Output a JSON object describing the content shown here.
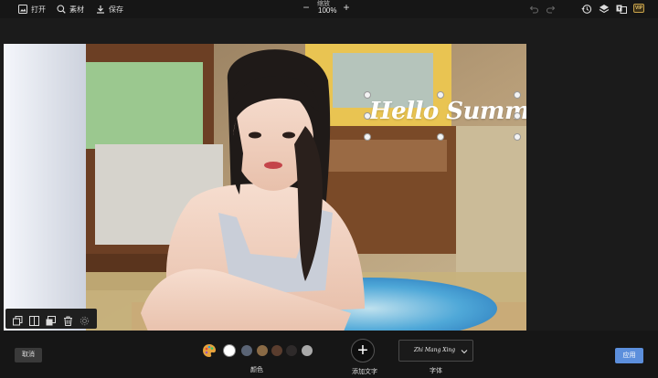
{
  "toolbar": {
    "open_label": "打开",
    "assets_label": "素材",
    "save_label": "保存",
    "zoom_label": "缩放",
    "zoom_value": "100%",
    "vip_label": "VIP"
  },
  "canvas": {
    "overlay_text": "Hello Summer"
  },
  "bottom": {
    "cancel_label": "取消",
    "apply_label": "应用",
    "color_label": "颜色",
    "add_text_label": "添加文字",
    "font_label": "字体",
    "font_value": "Zhi Mang Xing",
    "swatches": [
      "#ffffff",
      "#5a6475",
      "#8a6a45",
      "#5a3d2e",
      "#2e2a2a",
      "#a9a9a9"
    ],
    "selected_swatch": 0
  }
}
